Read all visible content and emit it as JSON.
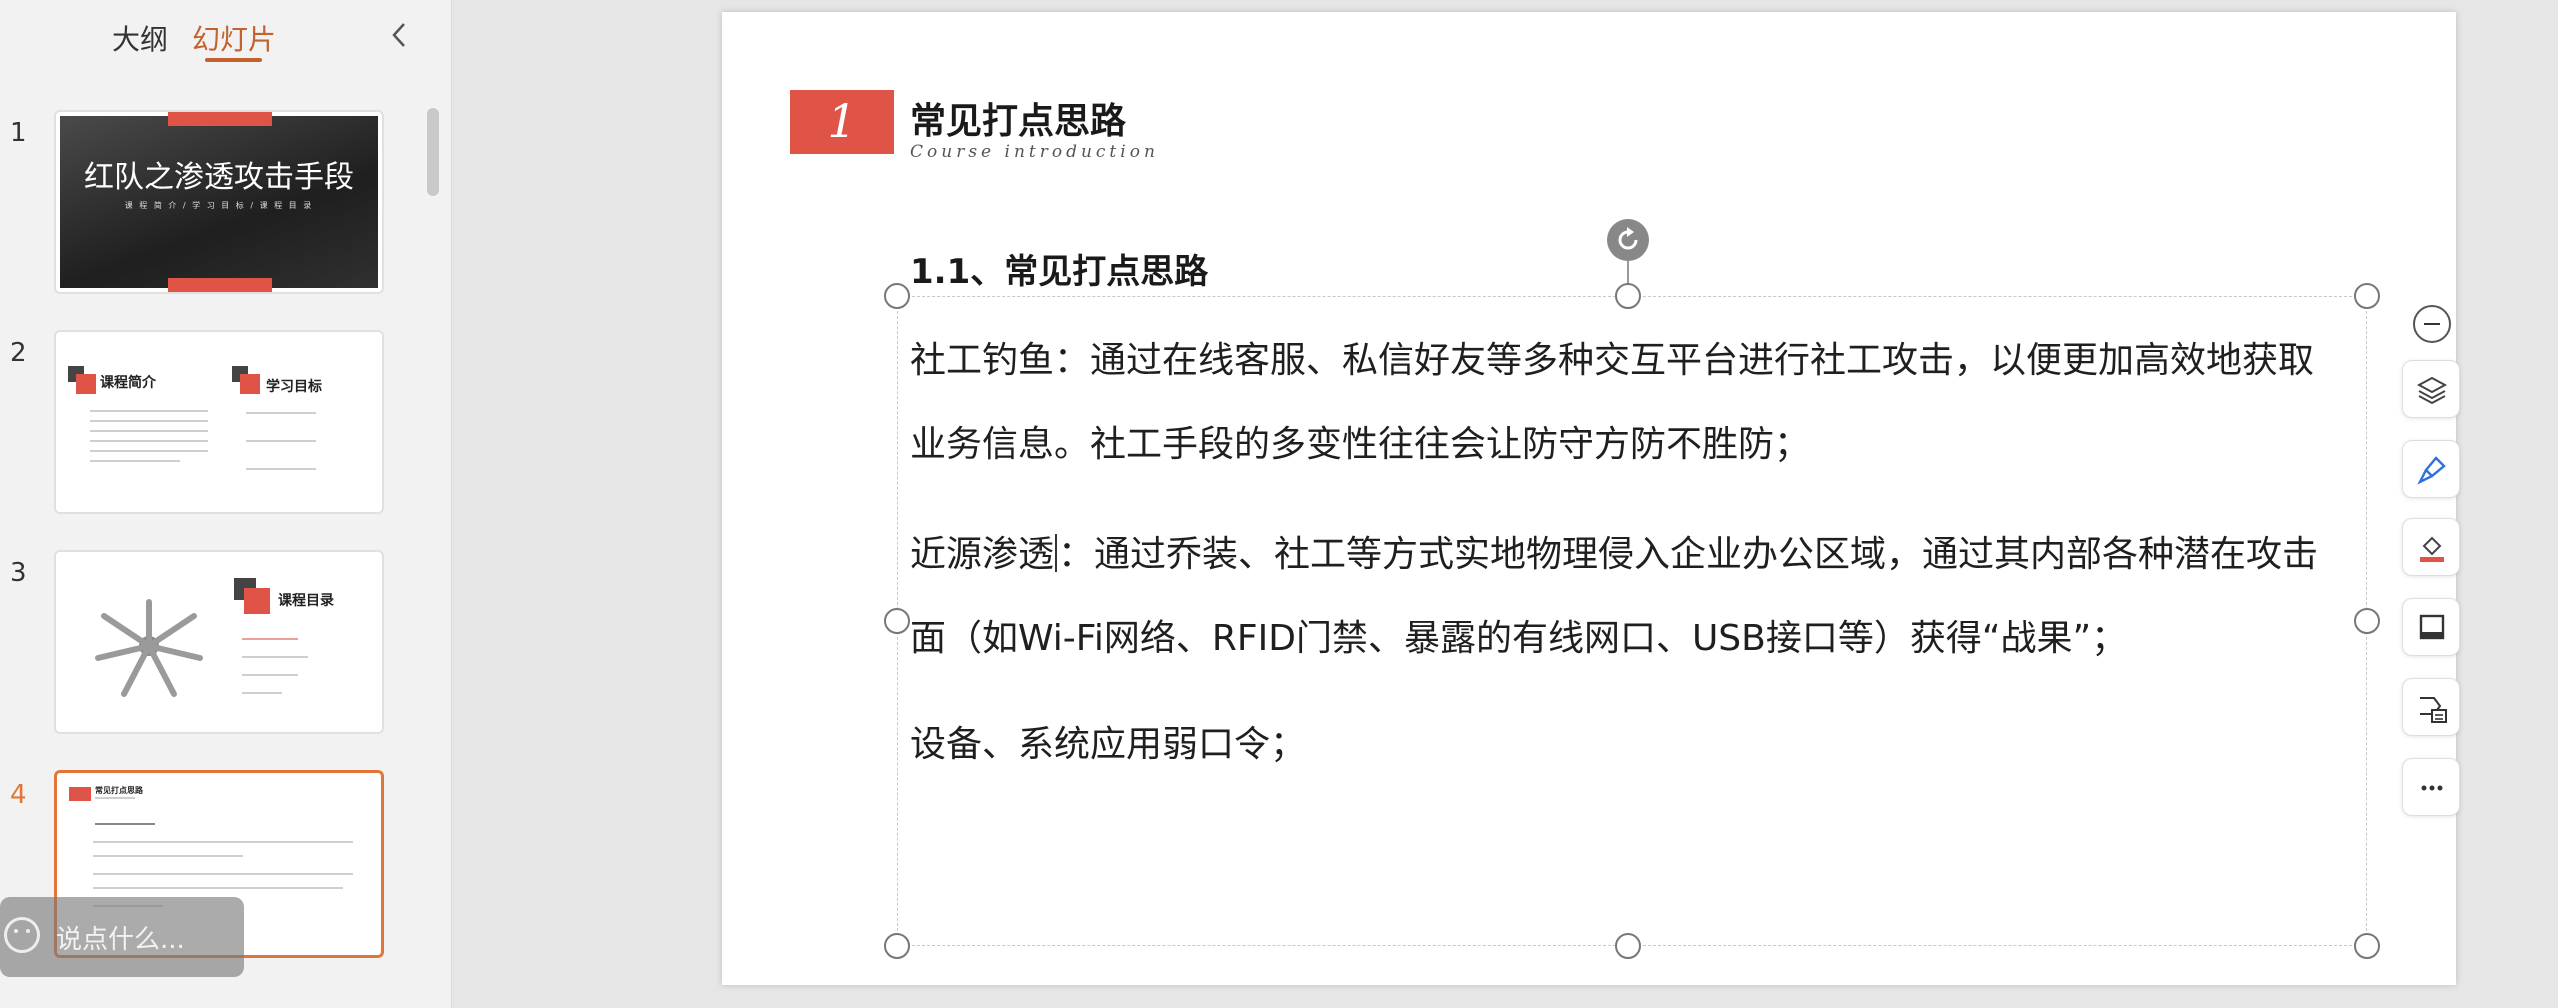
{
  "sidebar": {
    "tabs": {
      "outline": "大纲",
      "slides": "幻灯片"
    },
    "thumbnails": [
      {
        "number": "1",
        "title": "红队之渗透攻击手段",
        "subtitle": "课 程 简 介 / 学 习 目 标 / 课 程 目 录"
      },
      {
        "number": "2",
        "heading_a": "课程简介",
        "heading_b": "学习目标"
      },
      {
        "number": "3",
        "heading": "课程目录"
      },
      {
        "number": "4",
        "heading": "常见打点思路"
      }
    ]
  },
  "comment": {
    "placeholder": "说点什么..."
  },
  "slide": {
    "section_number": "1",
    "section_title": "常见打点思路",
    "section_subtitle": "Course introduction",
    "sub_heading": "1.1、常见打点思路",
    "para1_line1": "社工钓鱼：通过在线客服、私信好友等多种交互平台进行社工攻击，以便更加高效地获取",
    "para1_line2": "业务信息。社工手段的多变性往往会让防守方防不胜防；",
    "para2_line1_a": "近源渗透",
    "para2_line1_b": "：通过乔装、社工等方式实地物理侵入企业办公区域，通过其内部各种潜在攻击",
    "para2_line2": "面（如Wi-Fi网络、RFID门禁、暴露的有线网口、USB接口等）获得“战果”；",
    "para3": "设备、系统应用弱口令；"
  },
  "toolbar": {
    "icons": [
      "zoom-out-icon",
      "layers-icon",
      "brush-icon",
      "fill-color-icon",
      "frame-icon",
      "shape-text-icon",
      "more-icon"
    ]
  },
  "colors": {
    "accent": "#e05447",
    "active_tab": "#c4622d"
  }
}
